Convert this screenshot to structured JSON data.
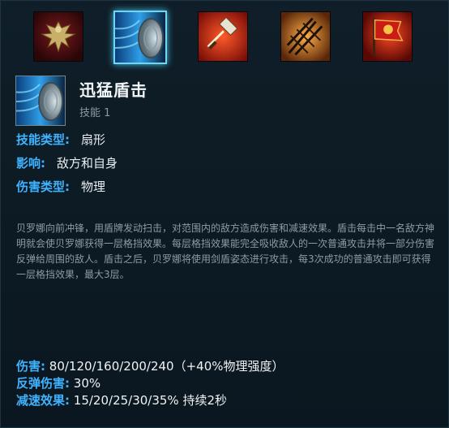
{
  "abilities": [
    {
      "name": "golden-eagle-emblem",
      "selected": false
    },
    {
      "name": "shield-bash",
      "selected": true
    },
    {
      "name": "hammer-strike",
      "selected": false
    },
    {
      "name": "spear-rack",
      "selected": false
    },
    {
      "name": "banner-flag",
      "selected": false
    }
  ],
  "skill": {
    "name": "迅猛盾击",
    "slot": "技能 1",
    "icon": "shield-icon"
  },
  "attributes": [
    {
      "label": "技能类型:",
      "value": "扇形"
    },
    {
      "label": "影响:",
      "value": "敌方和自身"
    },
    {
      "label": "伤害类型:",
      "value": "物理"
    }
  ],
  "description": "贝罗娜向前冲锋，用盾牌发动扫击，对范围内的敌方造成伤害和减速效果。盾击每击中一名敌方神明就会使贝罗娜获得一层格挡效果。每层格挡效果能完全吸收敌人的一次普通攻击并将一部分伤害反弹给周围的敌人。盾击之后，贝罗娜将使用剑盾姿态进行攻击，每3次成功的普通攻击即可获得一层格挡效果，最大3层。",
  "stats": [
    {
      "label": "伤害:",
      "value": "80/120/160/200/240（+40%物理强度）"
    },
    {
      "label": "反弹伤害:",
      "value": "30%"
    },
    {
      "label": "减速效果:",
      "value": "15/20/25/30/35% 持续2秒"
    }
  ],
  "colors": {
    "label_blue": "#3fb3ff",
    "highlight_cyan": "#6fd7f3",
    "background": "#0d1a23"
  }
}
